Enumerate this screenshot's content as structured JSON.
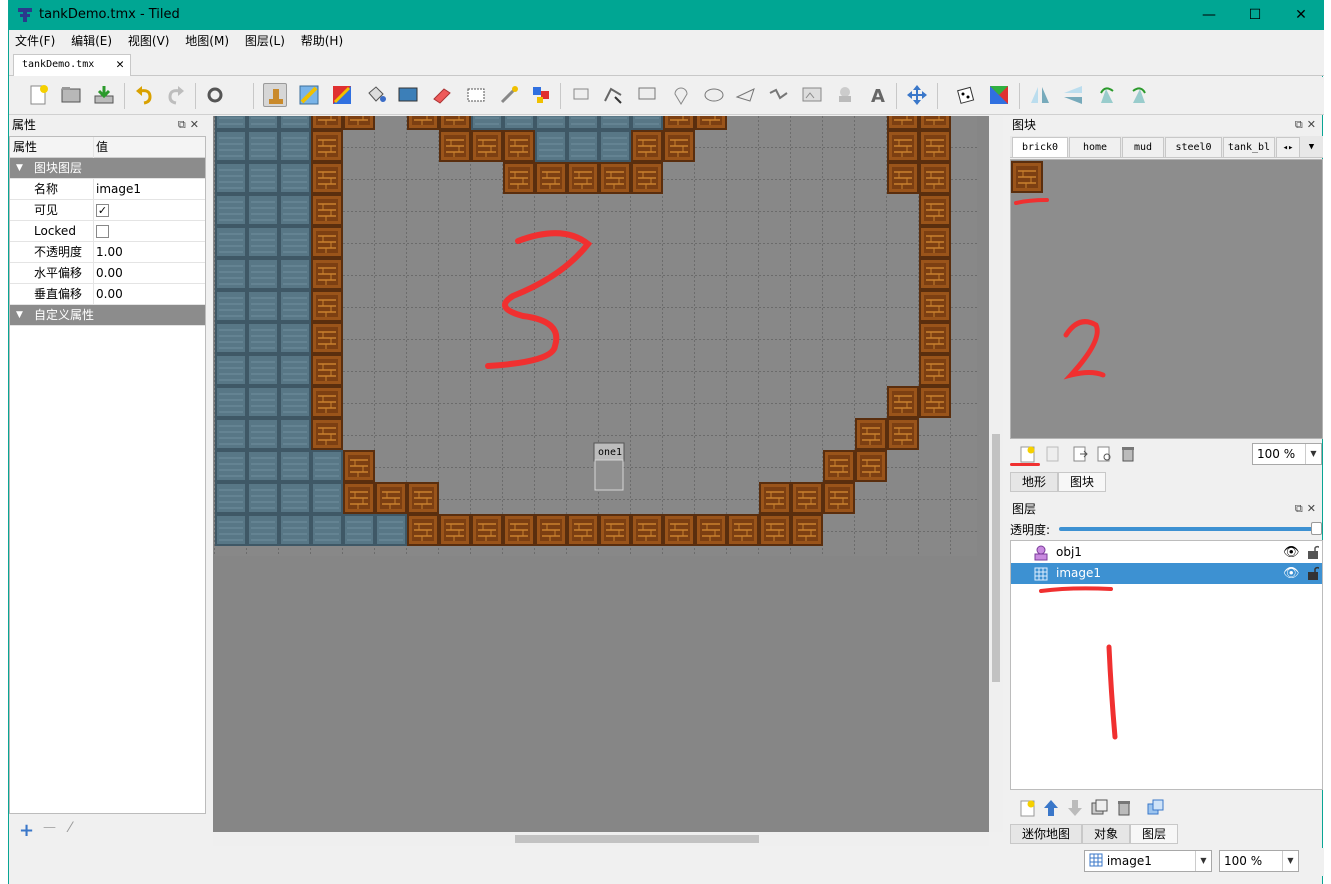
{
  "window": {
    "title": "tankDemo.tmx - Tiled",
    "minimize": "—",
    "maximize": "☐",
    "close": "✕"
  },
  "menu": [
    "文件(F)",
    "编辑(E)",
    "视图(V)",
    "地图(M)",
    "图层(L)",
    "帮助(H)"
  ],
  "document_tab": {
    "label": "tankDemo.tmx",
    "close": "✕"
  },
  "properties_panel": {
    "title": "属性",
    "header_key": "属性",
    "header_value": "值",
    "group1": "图块图层",
    "rows": [
      {
        "key": "名称",
        "value": "image1"
      },
      {
        "key": "可见",
        "value": "✓"
      },
      {
        "key": "Locked",
        "value": ""
      },
      {
        "key": "不透明度",
        "value": "1.00"
      },
      {
        "key": "水平偏移",
        "value": "0.00"
      },
      {
        "key": "垂直偏移",
        "value": "0.00"
      }
    ],
    "group2": "自定义属性",
    "add": "+",
    "remove": "—",
    "edit": "⁄"
  },
  "map": {
    "object_label": "one1",
    "annotation": "3"
  },
  "tilesets_panel": {
    "title": "图块",
    "tabs": [
      "brick0",
      "home",
      "mud",
      "steel0",
      "tank_bl"
    ],
    "zoom": "100 %",
    "annotation": "2",
    "bottom_tabs": [
      "地形",
      "图块"
    ]
  },
  "layers_panel": {
    "title": "图层",
    "opacity_label": "透明度:",
    "opacity": 1.0,
    "layers": [
      {
        "name": "obj1",
        "type": "object",
        "selected": false
      },
      {
        "name": "image1",
        "type": "tile",
        "selected": true
      }
    ],
    "annotation": "1",
    "bottom_tabs": [
      "迷你地图",
      "对象",
      "图层"
    ]
  },
  "statusbar": {
    "layer": "image1",
    "zoom": "100 %"
  },
  "colors": {
    "title_bg": "#00a693",
    "selection": "#3d91d2",
    "brick": "#8b4a16",
    "steel": "#4f6b78",
    "annotation": "#f03030"
  }
}
